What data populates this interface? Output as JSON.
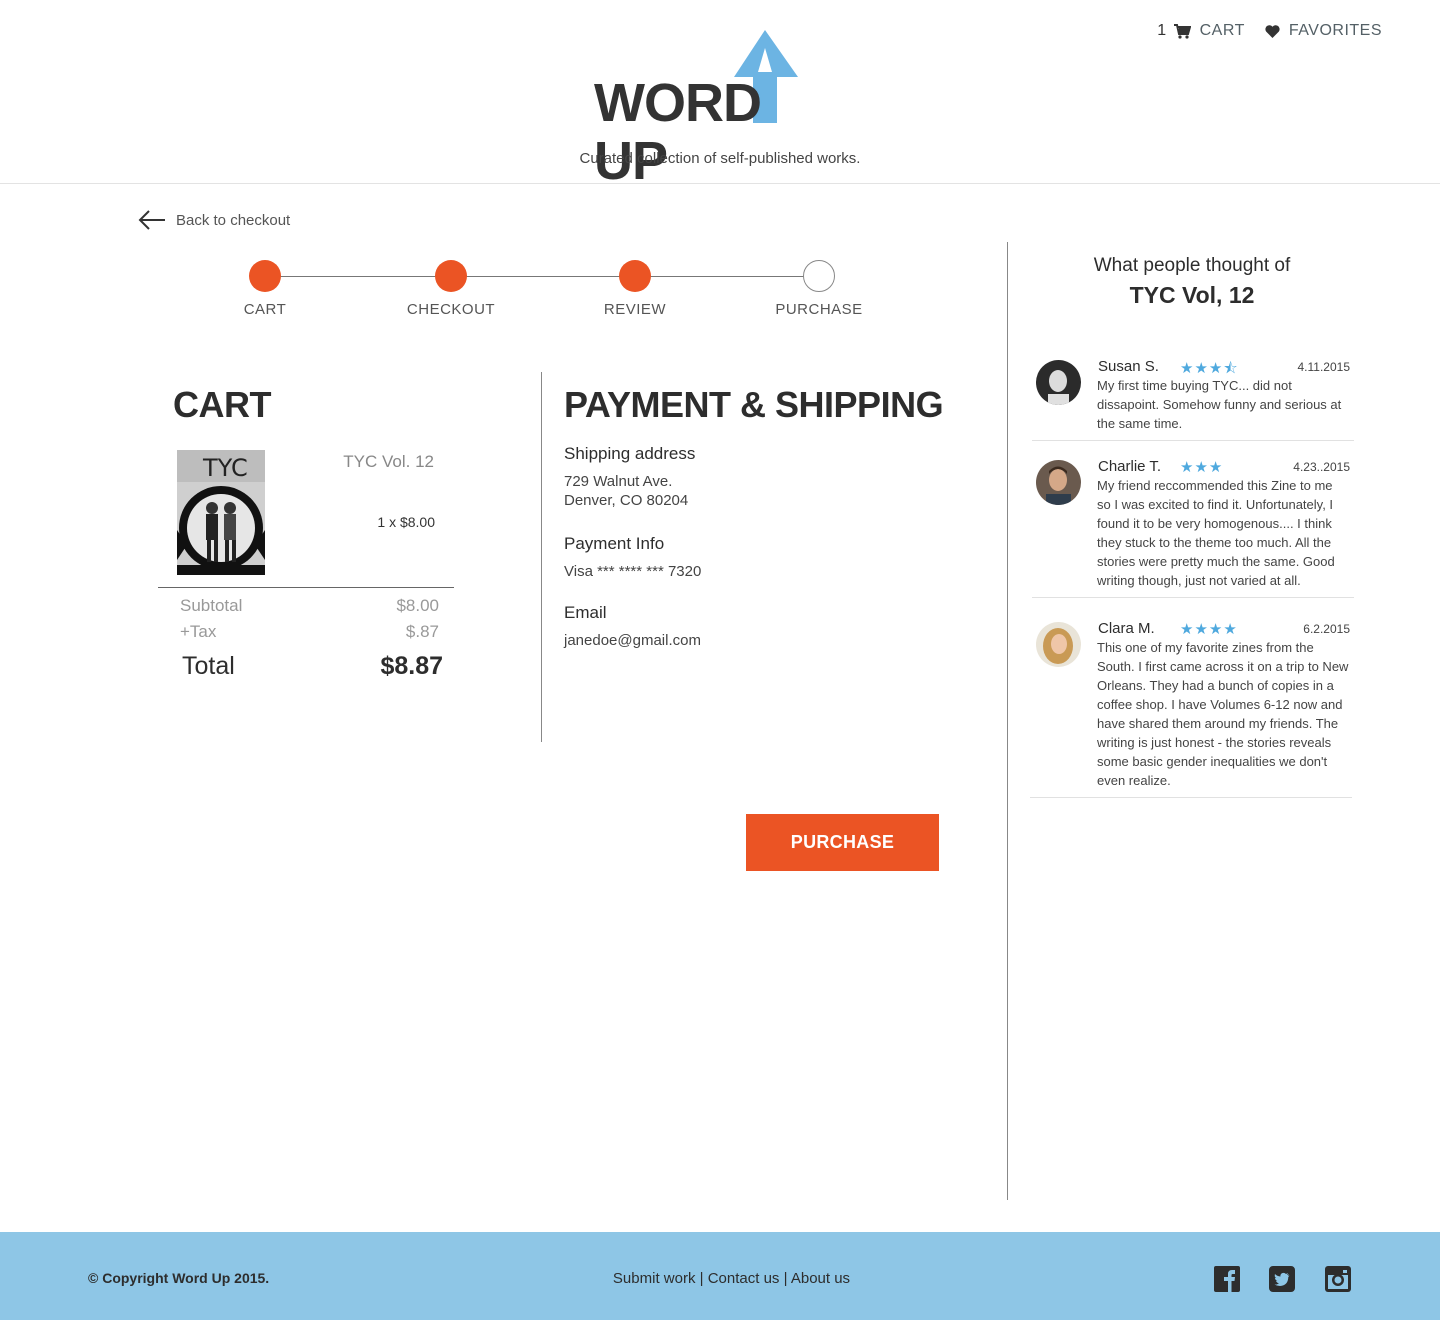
{
  "header": {
    "cart_count": "1",
    "cart_label": "CART",
    "favorites_label": "FAVORITES",
    "logo_text": "WORD UP",
    "tagline": "Curated collection of self-published works."
  },
  "back_link": "Back to checkout",
  "steps": [
    {
      "label": "CART",
      "status": "completed"
    },
    {
      "label": "CHECKOUT",
      "status": "completed"
    },
    {
      "label": "REVIEW",
      "status": "completed"
    },
    {
      "label": "PURCHASE",
      "status": "pending"
    }
  ],
  "cart": {
    "title": "CART",
    "item_name": "TYC Vol. 12",
    "item_qty_price": "1 x $8.00",
    "subtotal_label": "Subtotal",
    "subtotal_value": "$8.00",
    "tax_label": "+Tax",
    "tax_value": "$.87",
    "total_label": "Total",
    "total_value": "$8.87"
  },
  "payment": {
    "title": "PAYMENT & SHIPPING",
    "shipping_label": "Shipping address",
    "shipping_line1": "729 Walnut Ave.",
    "shipping_line2": "Denver, CO 80204",
    "payment_label": "Payment Info",
    "payment_value": "Visa *** **** *** 7320",
    "email_label": "Email",
    "email_value": "janedoe@gmail.com"
  },
  "purchase_button": "PURCHASE",
  "reviews": {
    "heading_line1": "What people thought of",
    "heading_line2": "TYC Vol, 12",
    "items": [
      {
        "name": "Susan S.",
        "rating": 3.5,
        "stars": "★★★⯪",
        "date": "4.11.2015",
        "text": "My first time buying TYC... did not dissapoint. Somehow funny and serious at the same time."
      },
      {
        "name": "Charlie T.",
        "rating": 3,
        "stars": "★★★",
        "date": "4.23..2015",
        "text": "My friend reccommended this Zine to me so I was excited to find it. Unfortunately, I found it to be very homogenous.... I think they stuck to the theme too much. All the stories were pretty much the same. Good writing though, just not varied at all."
      },
      {
        "name": "Clara M.",
        "rating": 4,
        "stars": "★★★★",
        "date": "6.2.2015",
        "text": "This one of my favorite zines from the South. I first came across it on a trip to New Orleans. They had a bunch of copies in a coffee shop. I have Volumes 6-12 now and have shared them around my friends. The writing is just honest - the stories reveals some basic gender inequalities we don't even realize."
      }
    ]
  },
  "footer": {
    "copyright": "© Copyright Word Up 2015.",
    "link_submit": "Submit work",
    "link_contact": "Contact us",
    "link_about": "About us",
    "separator": "|"
  },
  "colors": {
    "accent": "#eb5424",
    "logo_arrow": "#6cb4e3",
    "stars": "#4fa9de",
    "footer_bg": "#8ec6e6"
  }
}
